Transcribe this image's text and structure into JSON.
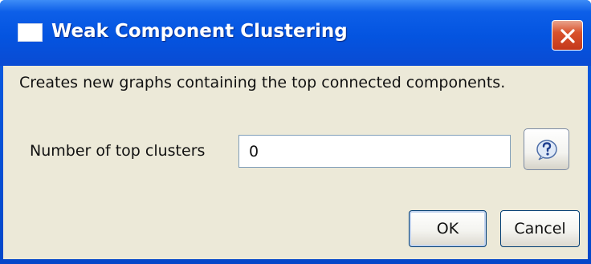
{
  "window": {
    "title": "Weak Component Clustering",
    "title_icon": "window-icon",
    "close_icon": "close-icon"
  },
  "dialog": {
    "description": "Creates new graphs containing the top connected components.",
    "field_label": "Number of top clusters",
    "field_value": "0",
    "help_icon": "help-icon"
  },
  "buttons": {
    "ok": "OK",
    "cancel": "Cancel"
  },
  "colors": {
    "titlebar": "#0454e0",
    "body": "#ece9d8",
    "close": "#d9532c"
  }
}
